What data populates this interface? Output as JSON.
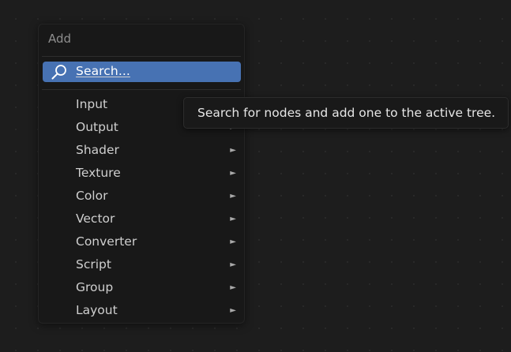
{
  "menu": {
    "title": "Add",
    "search": {
      "label": "Search...",
      "icon": "search-icon"
    },
    "items": [
      {
        "label": "Input",
        "has_submenu": true
      },
      {
        "label": "Output",
        "has_submenu": true
      },
      {
        "label": "Shader",
        "has_submenu": true
      },
      {
        "label": "Texture",
        "has_submenu": true
      },
      {
        "label": "Color",
        "has_submenu": true
      },
      {
        "label": "Vector",
        "has_submenu": true
      },
      {
        "label": "Converter",
        "has_submenu": true
      },
      {
        "label": "Script",
        "has_submenu": true
      },
      {
        "label": "Group",
        "has_submenu": true
      },
      {
        "label": "Layout",
        "has_submenu": true
      }
    ],
    "submenu_arrow": "►"
  },
  "tooltip": {
    "text": "Search for nodes and add one to the active tree."
  },
  "colors": {
    "background": "#1d1d1d",
    "menu_background": "#181818",
    "highlight": "#4772b3",
    "text": "#cfcfcf",
    "title_text": "#8e8e8e"
  }
}
